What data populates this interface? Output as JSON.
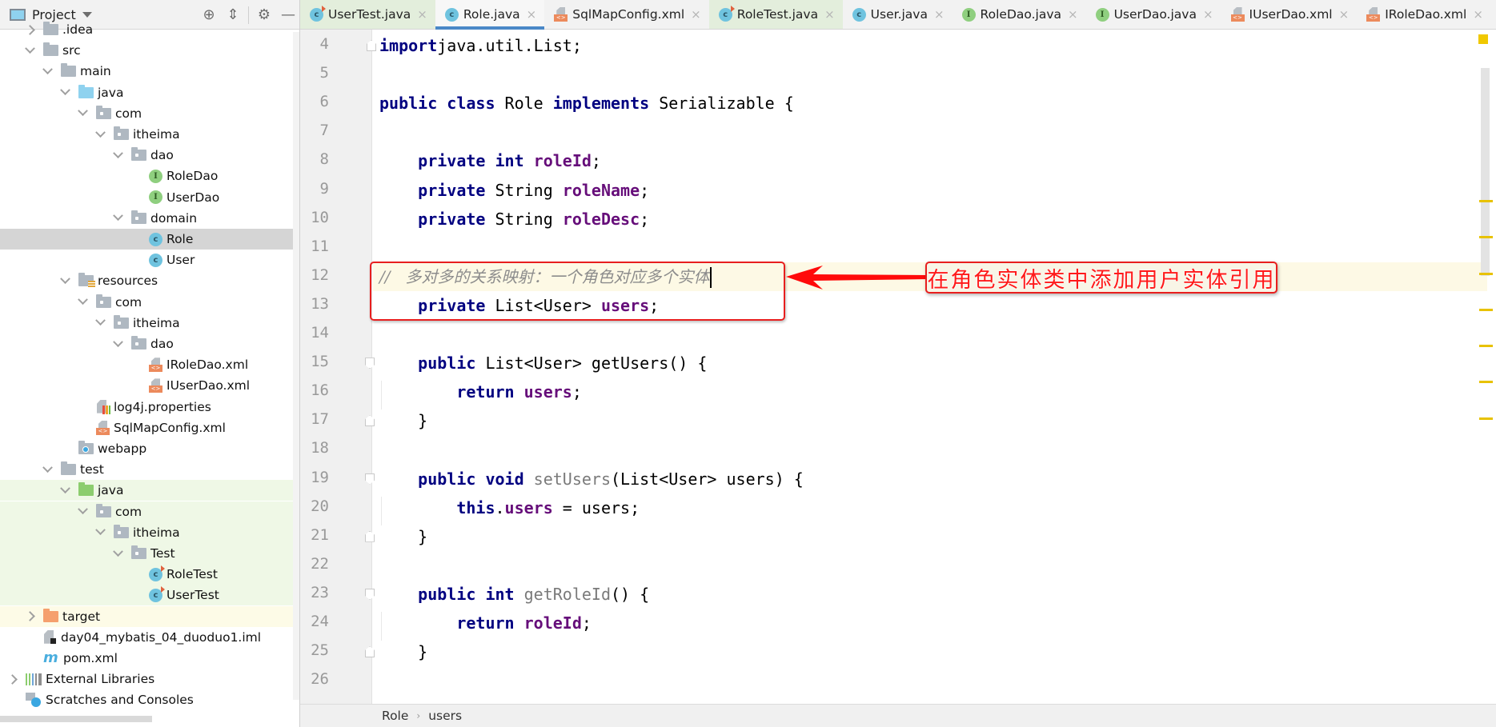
{
  "project_panel": {
    "title": "Project",
    "tools": [
      "locate-icon",
      "collapse-all-icon",
      "gear-icon",
      "minimize-icon"
    ]
  },
  "tree": [
    {
      "label": ".idea",
      "depth": 1,
      "chevron": "right",
      "icon": "folder"
    },
    {
      "label": "src",
      "depth": 1,
      "chevron": "down",
      "icon": "folder"
    },
    {
      "label": "main",
      "depth": 2,
      "chevron": "down",
      "icon": "folder"
    },
    {
      "label": "java",
      "depth": 3,
      "chevron": "down",
      "icon": "source-folder"
    },
    {
      "label": "com",
      "depth": 4,
      "chevron": "down",
      "icon": "package"
    },
    {
      "label": "itheima",
      "depth": 5,
      "chevron": "down",
      "icon": "package"
    },
    {
      "label": "dao",
      "depth": 6,
      "chevron": "down",
      "icon": "package"
    },
    {
      "label": "RoleDao",
      "depth": 7,
      "chevron": "none",
      "icon": "interface"
    },
    {
      "label": "UserDao",
      "depth": 7,
      "chevron": "none",
      "icon": "interface"
    },
    {
      "label": "domain",
      "depth": 6,
      "chevron": "down",
      "icon": "package"
    },
    {
      "label": "Role",
      "depth": 7,
      "chevron": "none",
      "icon": "class",
      "selected": true
    },
    {
      "label": "User",
      "depth": 7,
      "chevron": "none",
      "icon": "class"
    },
    {
      "label": "resources",
      "depth": 3,
      "chevron": "down",
      "icon": "resources-folder"
    },
    {
      "label": "com",
      "depth": 4,
      "chevron": "down",
      "icon": "package"
    },
    {
      "label": "itheima",
      "depth": 5,
      "chevron": "down",
      "icon": "package"
    },
    {
      "label": "dao",
      "depth": 6,
      "chevron": "down",
      "icon": "package"
    },
    {
      "label": "IRoleDao.xml",
      "depth": 7,
      "chevron": "none",
      "icon": "xml"
    },
    {
      "label": "IUserDao.xml",
      "depth": 7,
      "chevron": "none",
      "icon": "xml"
    },
    {
      "label": "log4j.properties",
      "depth": 4,
      "chevron": "none",
      "icon": "properties"
    },
    {
      "label": "SqlMapConfig.xml",
      "depth": 4,
      "chevron": "none",
      "icon": "xml"
    },
    {
      "label": "webapp",
      "depth": 3,
      "chevron": "none",
      "icon": "web-folder"
    },
    {
      "label": "test",
      "depth": 2,
      "chevron": "down",
      "icon": "folder"
    },
    {
      "label": "java",
      "depth": 3,
      "chevron": "down",
      "icon": "test-folder",
      "test": true
    },
    {
      "label": "com",
      "depth": 4,
      "chevron": "down",
      "icon": "package",
      "test": true
    },
    {
      "label": "itheima",
      "depth": 5,
      "chevron": "down",
      "icon": "package",
      "test": true
    },
    {
      "label": "Test",
      "depth": 6,
      "chevron": "down",
      "icon": "package",
      "test": true
    },
    {
      "label": "RoleTest",
      "depth": 7,
      "chevron": "none",
      "icon": "test-class",
      "test": true
    },
    {
      "label": "UserTest",
      "depth": 7,
      "chevron": "none",
      "icon": "test-class",
      "test": true
    },
    {
      "label": "target",
      "depth": 1,
      "chevron": "right",
      "icon": "excluded-folder",
      "excluded": true
    },
    {
      "label": "day04_mybatis_04_duoduo1.iml",
      "depth": 1,
      "chevron": "none",
      "icon": "iml"
    },
    {
      "label": "pom.xml",
      "depth": 1,
      "chevron": "none",
      "icon": "maven"
    },
    {
      "label": "External Libraries",
      "depth": 0,
      "chevron": "right",
      "icon": "libraries"
    },
    {
      "label": "Scratches and Consoles",
      "depth": 0,
      "chevron": "none",
      "icon": "scratches"
    }
  ],
  "tabs": [
    {
      "label": "UserTest.java",
      "icon": "test-class",
      "test": true
    },
    {
      "label": "Role.java",
      "icon": "class",
      "active": true
    },
    {
      "label": "SqlMapConfig.xml",
      "icon": "xml"
    },
    {
      "label": "RoleTest.java",
      "icon": "test-class",
      "test": true
    },
    {
      "label": "User.java",
      "icon": "class"
    },
    {
      "label": "RoleDao.java",
      "icon": "interface"
    },
    {
      "label": "UserDao.java",
      "icon": "interface"
    },
    {
      "label": "IUserDao.xml",
      "icon": "xml"
    },
    {
      "label": "IRoleDao.xml",
      "icon": "xml"
    }
  ],
  "editor": {
    "lines": [
      {
        "no": "4",
        "fold": "close-top",
        "tokens": [
          [
            "kw",
            "import"
          ],
          [
            "",
            "java.util.List;"
          ]
        ]
      },
      {
        "no": "5",
        "tokens": []
      },
      {
        "no": "6",
        "tokens": [
          [
            "kw",
            "public class "
          ],
          [
            "",
            "Role "
          ],
          [
            "kw",
            "implements "
          ],
          [
            "",
            "Serializable {"
          ]
        ]
      },
      {
        "no": "7",
        "tokens": []
      },
      {
        "no": "8",
        "tokens": [
          [
            "",
            "    "
          ],
          [
            "kw",
            "private int "
          ],
          [
            "fld",
            "roleId"
          ],
          [
            "",
            ";"
          ]
        ]
      },
      {
        "no": "9",
        "tokens": [
          [
            "",
            "    "
          ],
          [
            "kw",
            "private "
          ],
          [
            "",
            "String "
          ],
          [
            "fld",
            "roleName"
          ],
          [
            "",
            ";"
          ]
        ]
      },
      {
        "no": "10",
        "tokens": [
          [
            "",
            "    "
          ],
          [
            "kw",
            "private "
          ],
          [
            "",
            "String "
          ],
          [
            "fld",
            "roleDesc"
          ],
          [
            "",
            ";"
          ]
        ]
      },
      {
        "no": "11",
        "tokens": []
      },
      {
        "no": "12",
        "current": true,
        "tokens": [
          [
            "cmt",
            "//   多对多的关系映射：一个角色对应多个实体"
          ],
          [
            "caret",
            ""
          ]
        ]
      },
      {
        "no": "13",
        "tokens": [
          [
            "",
            "    "
          ],
          [
            "kw",
            "private "
          ],
          [
            "",
            "List<User> "
          ],
          [
            "fld",
            "users"
          ],
          [
            "",
            ";"
          ]
        ]
      },
      {
        "no": "14",
        "tokens": []
      },
      {
        "no": "15",
        "fold": "open",
        "tokens": [
          [
            "",
            "    "
          ],
          [
            "kw",
            "public "
          ],
          [
            "",
            "List<User> getUsers() {"
          ]
        ]
      },
      {
        "no": "16",
        "tokens": [
          [
            "",
            "        "
          ],
          [
            "kw",
            "return "
          ],
          [
            "fld",
            "users"
          ],
          [
            "",
            ";"
          ]
        ]
      },
      {
        "no": "17",
        "fold": "close",
        "tokens": [
          [
            "",
            "    }"
          ]
        ]
      },
      {
        "no": "18",
        "tokens": []
      },
      {
        "no": "19",
        "fold": "open",
        "tokens": [
          [
            "",
            "    "
          ],
          [
            "kw",
            "public void "
          ],
          [
            "unused",
            "setUsers"
          ],
          [
            "",
            "(List<User> users) {"
          ]
        ]
      },
      {
        "no": "20",
        "tokens": [
          [
            "",
            "        "
          ],
          [
            "kw",
            "this"
          ],
          [
            "",
            "."
          ],
          [
            "fld",
            "users"
          ],
          [
            "",
            " = users;"
          ]
        ]
      },
      {
        "no": "21",
        "fold": "close",
        "tokens": [
          [
            "",
            "    }"
          ]
        ]
      },
      {
        "no": "22",
        "tokens": []
      },
      {
        "no": "23",
        "fold": "open",
        "tokens": [
          [
            "",
            "    "
          ],
          [
            "kw",
            "public int "
          ],
          [
            "unused",
            "getRoleId"
          ],
          [
            "",
            "() {"
          ]
        ]
      },
      {
        "no": "24",
        "tokens": [
          [
            "",
            "        "
          ],
          [
            "kw",
            "return "
          ],
          [
            "fld",
            "roleId"
          ],
          [
            "",
            ";"
          ]
        ]
      },
      {
        "no": "25",
        "fold": "close",
        "tokens": [
          [
            "",
            "    }"
          ]
        ]
      },
      {
        "no": "26",
        "tokens": []
      }
    ]
  },
  "breadcrumbs": [
    "Role",
    "users"
  ],
  "annotation": {
    "callout_text": "在角色实体类中添加用户实体引用",
    "color": "#e81e1e"
  },
  "colors": {
    "keyword": "#000080",
    "field": "#660e7a",
    "comment": "#8c8c8c",
    "active_tab_underline": "#4a88c7",
    "warning_mark": "#e8c200"
  }
}
